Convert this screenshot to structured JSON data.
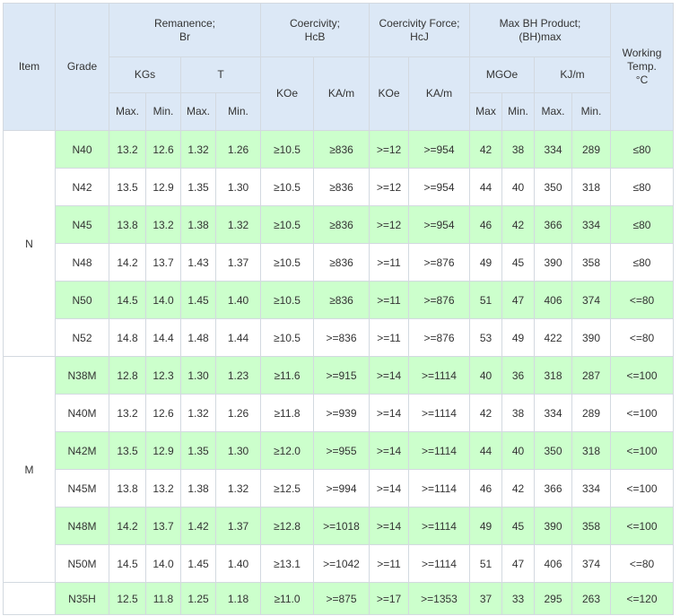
{
  "header": {
    "item": "Item",
    "grade": "Grade",
    "remanence_l1": "Remanence;",
    "remanence_l2": "Br",
    "coercivity_l1": "Coercivity;",
    "coercivity_l2": "HcB",
    "force_l1": "Coercivity Force;",
    "force_l2": "HcJ",
    "bh_l1": "Max BH Product;",
    "bh_l2": "(BH)max",
    "working_l1": "Working",
    "working_l2": "Temp.",
    "working_l3": "°C",
    "kgs": "KGs",
    "t": "T",
    "koe_hcb": "KOe",
    "kam_hcb": "KA/m",
    "koe_hcj": "KOe",
    "kam_hcj": "KA/m",
    "mgoe": "MGOe",
    "kjm": "KJ/m",
    "max1": "Max.",
    "min1": "Min.",
    "max2": "Max.",
    "min2": "Min.",
    "max3": "Max",
    "min3": "Min.",
    "max4": "Max.",
    "min4": "Min."
  },
  "groups": [
    {
      "label": "N"
    },
    {
      "label": "M"
    }
  ],
  "rows": [
    [
      "N40",
      "13.2",
      "12.6",
      "1.32",
      "1.26",
      "≥10.5",
      "≥836",
      ">=12",
      ">=954",
      "42",
      "38",
      "334",
      "289",
      "≤80"
    ],
    [
      "N42",
      "13.5",
      "12.9",
      "1.35",
      "1.30",
      "≥10.5",
      "≥836",
      ">=12",
      ">=954",
      "44",
      "40",
      "350",
      "318",
      "≤80"
    ],
    [
      "N45",
      "13.8",
      "13.2",
      "1.38",
      "1.32",
      "≥10.5",
      "≥836",
      ">=12",
      ">=954",
      "46",
      "42",
      "366",
      "334",
      "≤80"
    ],
    [
      "N48",
      "14.2",
      "13.7",
      "1.43",
      "1.37",
      "≥10.5",
      "≥836",
      ">=11",
      ">=876",
      "49",
      "45",
      "390",
      "358",
      "≤80"
    ],
    [
      "N50",
      "14.5",
      "14.0",
      "1.45",
      "1.40",
      "≥10.5",
      "≥836",
      ">=11",
      ">=876",
      "51",
      "47",
      "406",
      "374",
      "<=80"
    ],
    [
      "N52",
      "14.8",
      "14.4",
      "1.48",
      "1.44",
      "≥10.5",
      ">=836",
      ">=11",
      ">=876",
      "53",
      "49",
      "422",
      "390",
      "<=80"
    ],
    [
      "N38M",
      "12.8",
      "12.3",
      "1.30",
      "1.23",
      "≥11.6",
      ">=915",
      ">=14",
      ">=1114",
      "40",
      "36",
      "318",
      "287",
      "<=100"
    ],
    [
      "N40M",
      "13.2",
      "12.6",
      "1.32",
      "1.26",
      "≥11.8",
      ">=939",
      ">=14",
      ">=1114",
      "42",
      "38",
      "334",
      "289",
      "<=100"
    ],
    [
      "N42M",
      "13.5",
      "12.9",
      "1.35",
      "1.30",
      "≥12.0",
      ">=955",
      ">=14",
      ">=1114",
      "44",
      "40",
      "350",
      "318",
      "<=100"
    ],
    [
      "N45M",
      "13.8",
      "13.2",
      "1.38",
      "1.32",
      "≥12.5",
      ">=994",
      ">=14",
      ">=1114",
      "46",
      "42",
      "366",
      "334",
      "<=100"
    ],
    [
      "N48M",
      "14.2",
      "13.7",
      "1.42",
      "1.37",
      "≥12.8",
      ">=1018",
      ">=14",
      ">=1114",
      "49",
      "45",
      "390",
      "358",
      "<=100"
    ],
    [
      "N50M",
      "14.5",
      "14.0",
      "1.45",
      "1.40",
      "≥13.1",
      ">=1042",
      ">=11",
      ">=1114",
      "51",
      "47",
      "406",
      "374",
      "<=80"
    ],
    [
      "N35H",
      "12.5",
      "11.8",
      "1.25",
      "1.18",
      "≥11.0",
      ">=875",
      ">=17",
      ">=1353",
      "37",
      "33",
      "295",
      "263",
      "<=120"
    ]
  ]
}
